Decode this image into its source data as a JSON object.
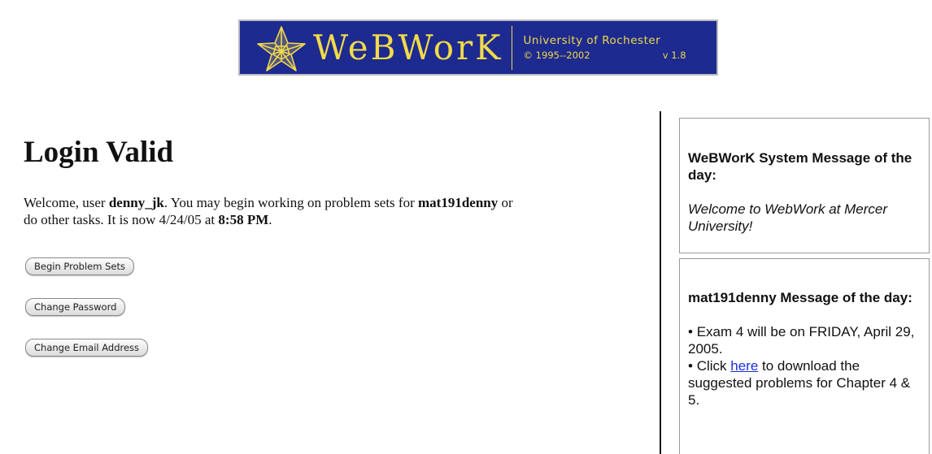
{
  "banner": {
    "brand": "WeBWorK",
    "institution": "University of Rochester",
    "copyright": "© 1995--2002",
    "version": "v 1.8"
  },
  "page": {
    "title": "Login Valid",
    "welcome": {
      "prefix": "Welcome, user ",
      "user": "denny_jk",
      "middle": ". You may begin working on problem sets for ",
      "course": "mat191denny",
      "suffix1": " or",
      "line2_prefix": "do other tasks. It is now 4/24/05 at ",
      "time": "8:58 PM",
      "line2_suffix": "."
    }
  },
  "buttons": {
    "begin": "Begin Problem Sets",
    "password": "Change Password",
    "email": "Change Email Address"
  },
  "system_message": {
    "title": "WeBWorK System Message of the day:",
    "body": "Welcome to WebWork at Mercer University!"
  },
  "course_message": {
    "title": "mat191denny Message of the day:",
    "item1": "Exam 4 will be on FRIDAY, April 29, 2005.",
    "item2_prefix": "Click ",
    "item2_link": "here",
    "item2_suffix": " to download the suggested problems for Chapter 4 & 5."
  },
  "colors": {
    "banner_bg": "#1d2a8f",
    "banner_text": "#f2da4a",
    "link": "#1a2ee0"
  }
}
